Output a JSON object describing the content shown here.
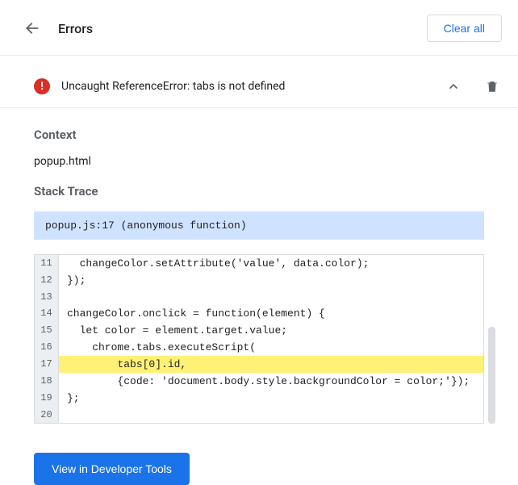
{
  "header": {
    "title": "Errors",
    "clear_all_label": "Clear all"
  },
  "error": {
    "message": "Uncaught ReferenceError: tabs is not defined"
  },
  "context": {
    "heading": "Context",
    "value": "popup.html"
  },
  "stack_trace": {
    "heading": "Stack Trace",
    "location": "popup.js:17 (anonymous function)"
  },
  "code": {
    "lines": [
      {
        "num": "11",
        "text": "  changeColor.setAttribute('value', data.color);",
        "highlight": false
      },
      {
        "num": "12",
        "text": "});",
        "highlight": false
      },
      {
        "num": "13",
        "text": "",
        "highlight": false
      },
      {
        "num": "14",
        "text": "changeColor.onclick = function(element) {",
        "highlight": false
      },
      {
        "num": "15",
        "text": "  let color = element.target.value;",
        "highlight": false
      },
      {
        "num": "16",
        "text": "    chrome.tabs.executeScript(",
        "highlight": false
      },
      {
        "num": "17",
        "text": "        tabs[0].id,",
        "highlight": true
      },
      {
        "num": "18",
        "text": "        {code: 'document.body.style.backgroundColor = color;'});",
        "highlight": false
      },
      {
        "num": "19",
        "text": "};",
        "highlight": false
      },
      {
        "num": "20",
        "text": "",
        "highlight": false
      }
    ]
  },
  "footer": {
    "view_devtools_label": "View in Developer Tools"
  }
}
